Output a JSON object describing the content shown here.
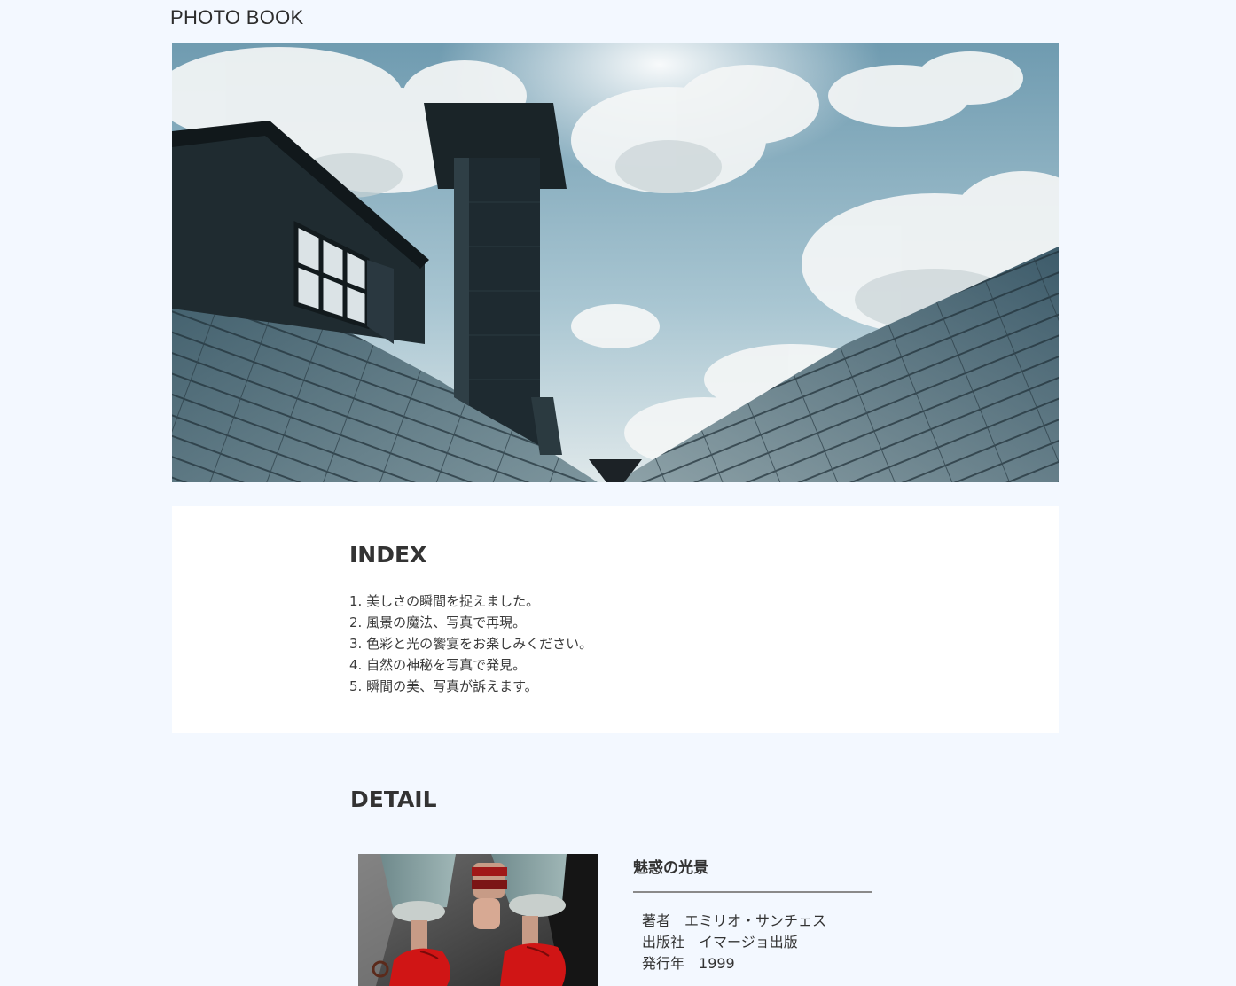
{
  "header": {
    "site_title": "PHOTO BOOK"
  },
  "hero": {
    "image_description_icon": "rooftop-chimney-sky-photo"
  },
  "index": {
    "heading": "INDEX",
    "items": [
      "1. 美しさの瞬間を捉えました。",
      "2. 風景の魔法、写真で再現。",
      "3. 色彩と光の饗宴をお楽しみください。",
      "4. 自然の神秘を写真で発見。",
      "5. 瞬間の美、写真が訴えます。"
    ]
  },
  "detail": {
    "heading": "DETAIL",
    "photo_icon": "red-shoes-photo",
    "book": {
      "title": "魅惑の光景",
      "meta": [
        {
          "key": "著者",
          "value": "エミリオ・サンチェス"
        },
        {
          "key": "出版社",
          "value": "イマージョ出版"
        },
        {
          "key": "発行年",
          "value": "1999"
        }
      ]
    }
  },
  "colors": {
    "background": "#f3f8ff",
    "panel": "#ffffff",
    "text": "#333333",
    "rule": "#8a8a8a"
  }
}
